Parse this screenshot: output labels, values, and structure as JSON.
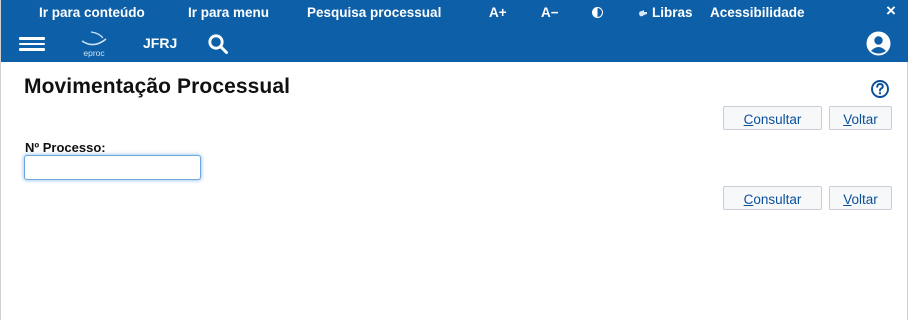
{
  "accessibility_bar": {
    "skip_content": "Ir para conteúdo",
    "skip_menu": "Ir para menu",
    "process_search": "Pesquisa processual",
    "font_increase": "A+",
    "font_decrease": "A−",
    "libras": "Libras",
    "accessibility": "Acessibilidade",
    "close": "×"
  },
  "navbar": {
    "logo_text": "eproc",
    "org": "JFRJ"
  },
  "main": {
    "title": "Movimentação Processual",
    "field_label": "Nº Processo:",
    "field_value": "",
    "consult_label_rest": "onsultar",
    "consult_accesskey": "C",
    "back_label_rest": "oltar",
    "back_accesskey": "V"
  },
  "colors": {
    "header_blue": "#0d5fa8",
    "link_blue": "#0a4f9a",
    "input_focus": "#6ea8de"
  },
  "icons": [
    "menu-icon",
    "eproc-logo",
    "search-icon",
    "contrast-icon",
    "libras-icon",
    "user-icon",
    "help-icon"
  ]
}
